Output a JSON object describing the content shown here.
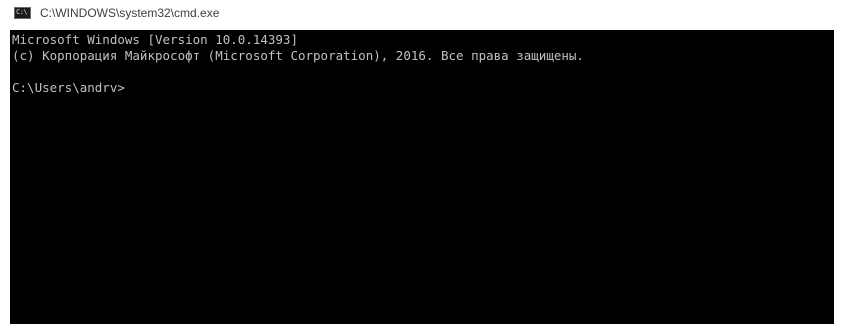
{
  "window": {
    "title": "C:\\WINDOWS\\system32\\cmd.exe",
    "icon": "cmd-icon",
    "icon_text": "C:\\"
  },
  "console": {
    "lines": [
      "Microsoft Windows [Version 10.0.14393]",
      "(c) Корпорация Майкрософт (Microsoft Corporation), 2016. Все права защищены.",
      "",
      "C:\\Users\\andrv>"
    ],
    "colors": {
      "background": "#000000",
      "foreground": "#c0c0c0"
    }
  }
}
